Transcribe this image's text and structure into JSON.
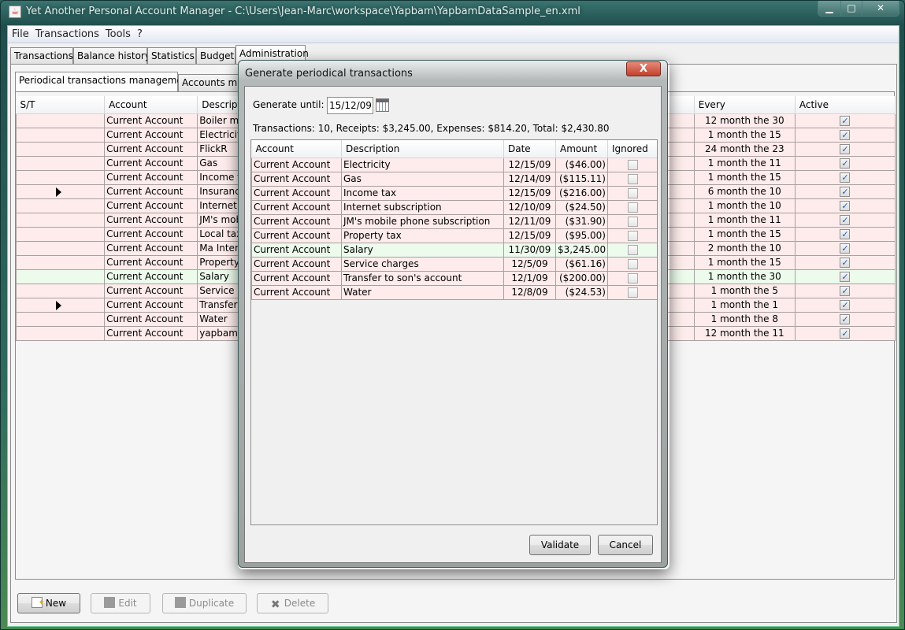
{
  "window": {
    "title": "Yet Another Personal Account Manager - C:\\Users\\Jean-Marc\\workspace\\Yapbam\\YapbamDataSample_en.xml",
    "controls": [
      "minimize",
      "maximize",
      "close"
    ]
  },
  "menu": [
    "File",
    "Transactions",
    "Tools",
    "?"
  ],
  "main_tabs": [
    {
      "label": "Transactions",
      "selected": false
    },
    {
      "label": "Balance history",
      "selected": false
    },
    {
      "label": "Statistics",
      "selected": false
    },
    {
      "label": "Budget",
      "selected": false
    },
    {
      "label": "Administration",
      "selected": true
    }
  ],
  "admin_tabs": [
    {
      "label": "Periodical transactions management",
      "selected": true
    },
    {
      "label": "Accounts man",
      "selected": false
    }
  ],
  "periodical_table": {
    "columns": [
      "S/T",
      "Account",
      "Descriptio",
      "Every",
      "Active"
    ],
    "rows": [
      {
        "st": "",
        "account": "Current Account",
        "description": "Boiler mair",
        "every": "12 month the 30",
        "active": true,
        "type": "expense"
      },
      {
        "st": "",
        "account": "Current Account",
        "description": "Electricity",
        "every": "1 month the 15",
        "active": true,
        "type": "expense"
      },
      {
        "st": "",
        "account": "Current Account",
        "description": "FlickR",
        "every": "24 month the 23",
        "active": true,
        "type": "expense"
      },
      {
        "st": "",
        "account": "Current Account",
        "description": "Gas",
        "every": "1 month the 11",
        "active": true,
        "type": "expense"
      },
      {
        "st": "",
        "account": "Current Account",
        "description": "Income ta",
        "every": "1 month the 15",
        "active": true,
        "type": "expense"
      },
      {
        "st": "arrow",
        "account": "Current Account",
        "description": "Insurance",
        "every": "6 month the 10",
        "active": true,
        "type": "expense"
      },
      {
        "st": "",
        "account": "Current Account",
        "description": "Internet s",
        "every": "1 month the 10",
        "active": true,
        "type": "expense"
      },
      {
        "st": "",
        "account": "Current Account",
        "description": "JM's mobil",
        "every": "1 month the 11",
        "active": true,
        "type": "expense"
      },
      {
        "st": "",
        "account": "Current Account",
        "description": "Local tax",
        "every": "1 month the 15",
        "active": true,
        "type": "expense"
      },
      {
        "st": "",
        "account": "Current Account",
        "description": "Ma Intern",
        "every": "2 month the 10",
        "active": true,
        "type": "expense"
      },
      {
        "st": "",
        "account": "Current Account",
        "description": "Property t",
        "every": "1 month the 15",
        "active": true,
        "type": "expense"
      },
      {
        "st": "",
        "account": "Current Account",
        "description": "Salary",
        "every": "1 month the 30",
        "active": true,
        "type": "income"
      },
      {
        "st": "",
        "account": "Current Account",
        "description": "Service ch",
        "every": "1 month the 5",
        "active": true,
        "type": "expense"
      },
      {
        "st": "arrow",
        "account": "Current Account",
        "description": "Transfer t",
        "every": "1 month the 1",
        "active": true,
        "type": "expense"
      },
      {
        "st": "",
        "account": "Current Account",
        "description": "Water",
        "every": "1 month the 8",
        "active": true,
        "type": "expense"
      },
      {
        "st": "",
        "account": "Current Account",
        "description": "yapbam.n",
        "every": "12 month the 11",
        "active": true,
        "type": "expense"
      }
    ]
  },
  "bottom_buttons": [
    {
      "label": "New",
      "icon": "new-document-icon",
      "enabled": true
    },
    {
      "label": "Edit",
      "icon": "edit-icon",
      "enabled": false
    },
    {
      "label": "Duplicate",
      "icon": "duplicate-icon",
      "enabled": false
    },
    {
      "label": "Delete",
      "icon": "delete-x-icon",
      "enabled": false
    }
  ],
  "dialog": {
    "title": "Generate periodical transactions",
    "close_label": "X",
    "generate_until_label": "Generate until:",
    "generate_until_value": "15/12/09",
    "summary": "Transactions: 10, Receipts: $3,245.00, Expenses: $814.20, Total: $2,430.80",
    "columns": [
      "Account",
      "Description",
      "Date",
      "Amount",
      "Ignored"
    ],
    "rows": [
      {
        "account": "Current Account",
        "description": "Electricity",
        "date": "12/15/09",
        "amount": "($46.00)",
        "ignored": false,
        "type": "expense"
      },
      {
        "account": "Current Account",
        "description": "Gas",
        "date": "12/14/09",
        "amount": "($115.11)",
        "ignored": false,
        "type": "expense"
      },
      {
        "account": "Current Account",
        "description": "Income tax",
        "date": "12/15/09",
        "amount": "($216.00)",
        "ignored": false,
        "type": "expense"
      },
      {
        "account": "Current Account",
        "description": "Internet subscription",
        "date": "12/10/09",
        "amount": "($24.50)",
        "ignored": false,
        "type": "expense"
      },
      {
        "account": "Current Account",
        "description": "JM's mobile phone subscription",
        "date": "12/11/09",
        "amount": "($31.90)",
        "ignored": false,
        "type": "expense"
      },
      {
        "account": "Current Account",
        "description": "Property tax",
        "date": "12/15/09",
        "amount": "($95.00)",
        "ignored": false,
        "type": "expense"
      },
      {
        "account": "Current Account",
        "description": "Salary",
        "date": "11/30/09",
        "amount": "$3,245.00",
        "ignored": false,
        "type": "income"
      },
      {
        "account": "Current Account",
        "description": "Service charges",
        "date": "12/5/09",
        "amount": "($61.16)",
        "ignored": false,
        "type": "expense"
      },
      {
        "account": "Current Account",
        "description": "Transfer to son's account",
        "date": "12/1/09",
        "amount": "($200.00)",
        "ignored": false,
        "type": "expense"
      },
      {
        "account": "Current Account",
        "description": "Water",
        "date": "12/8/09",
        "amount": "($24.53)",
        "ignored": false,
        "type": "expense"
      }
    ],
    "validate_label": "Validate",
    "cancel_label": "Cancel"
  },
  "colors": {
    "expense_row": "#fdeceb",
    "income_row": "#ecfbec",
    "checkbox_check": "#2c5ab0"
  }
}
